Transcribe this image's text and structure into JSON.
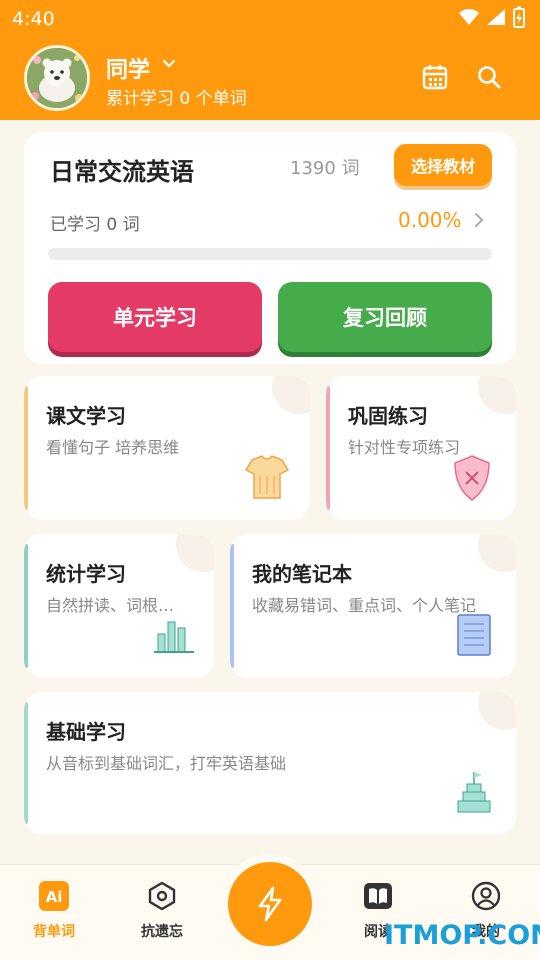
{
  "status": {
    "time": "4:40"
  },
  "header": {
    "user_name": "同学",
    "sub_text": "累计学习 0 个单词"
  },
  "book": {
    "title": "日常交流英语",
    "word_count": "1390 词",
    "choose_label": "选择教材",
    "learned_label": "已学习 0 词",
    "progress_text": "0.00%",
    "progress_fraction": 0
  },
  "actions": {
    "unit_study": "单元学习",
    "review": "复习回顾"
  },
  "cards": {
    "text_study": {
      "title": "课文学习",
      "subtitle": "看懂句子 培养思维"
    },
    "practice": {
      "title": "巩固练习",
      "subtitle": "针对性专项练习"
    },
    "stats": {
      "title": "统计学习",
      "subtitle": "自然拼读、词根…"
    },
    "notebook": {
      "title": "我的笔记本",
      "subtitle": "收藏易错词、重点词、个人笔记"
    },
    "basics": {
      "title": "基础学习",
      "subtitle": "从音标到基础词汇，打牢英语基础"
    }
  },
  "nav": {
    "items": [
      {
        "label": "背单词",
        "icon": "ai-icon"
      },
      {
        "label": "抗遗忘",
        "icon": "hexagon-icon"
      },
      {
        "label": "",
        "icon": "lightning-icon"
      },
      {
        "label": "阅读",
        "icon": "book-icon"
      },
      {
        "label": "我的",
        "icon": "profile-icon"
      }
    ]
  },
  "watermark": "ITMOP.COM",
  "colors": {
    "accent": "#ff9a0e",
    "unit_button": "#e43a66",
    "review_button": "#45ab4b"
  }
}
